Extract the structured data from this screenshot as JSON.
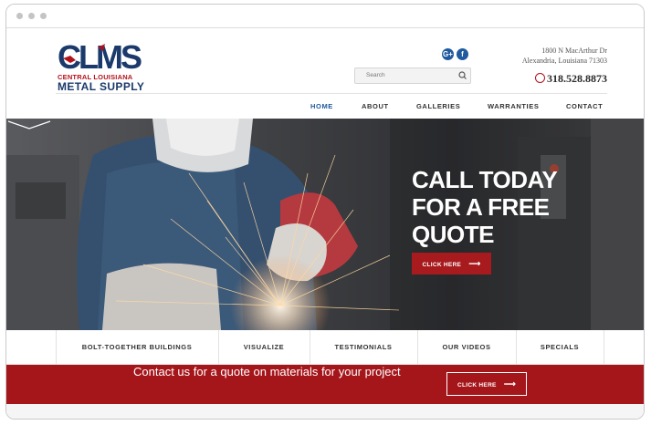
{
  "header": {
    "logo_text": "CLMS",
    "logo_line1": "CENTRAL LOUISIANA",
    "logo_line2": "METAL SUPPLY",
    "social": [
      {
        "icon": "google-plus-icon",
        "glyph": "G+"
      },
      {
        "icon": "facebook-icon",
        "glyph": "f"
      }
    ],
    "search_placeholder": "Search",
    "address_line1": "1800 N MacArthur Dr",
    "address_line2": "Alexandria, Louisiana 71303",
    "phone": "318.528.8873"
  },
  "nav": {
    "items": [
      "HOME",
      "ABOUT",
      "GALLERIES",
      "WARRANTIES",
      "CONTACT"
    ],
    "active": "HOME"
  },
  "hero": {
    "title_lines": [
      "CALL TODAY",
      "FOR A FREE",
      "QUOTE"
    ],
    "button_label": "CLICK HERE",
    "button_arrow": "⟶"
  },
  "subnav": {
    "items": [
      "BOLT-TOGETHER BUILDINGS",
      "VISUALIZE",
      "TESTIMONIALS",
      "OUR VIDEOS",
      "SPECIALS"
    ]
  },
  "banner": {
    "text": "Contact us for a quote on materials for your project",
    "button_label": "CLICK HERE",
    "button_arrow": "⟶"
  },
  "colors": {
    "brand_red": "#a5161b",
    "brand_blue": "#1f5a9e",
    "logo_navy": "#1b3a6b"
  }
}
